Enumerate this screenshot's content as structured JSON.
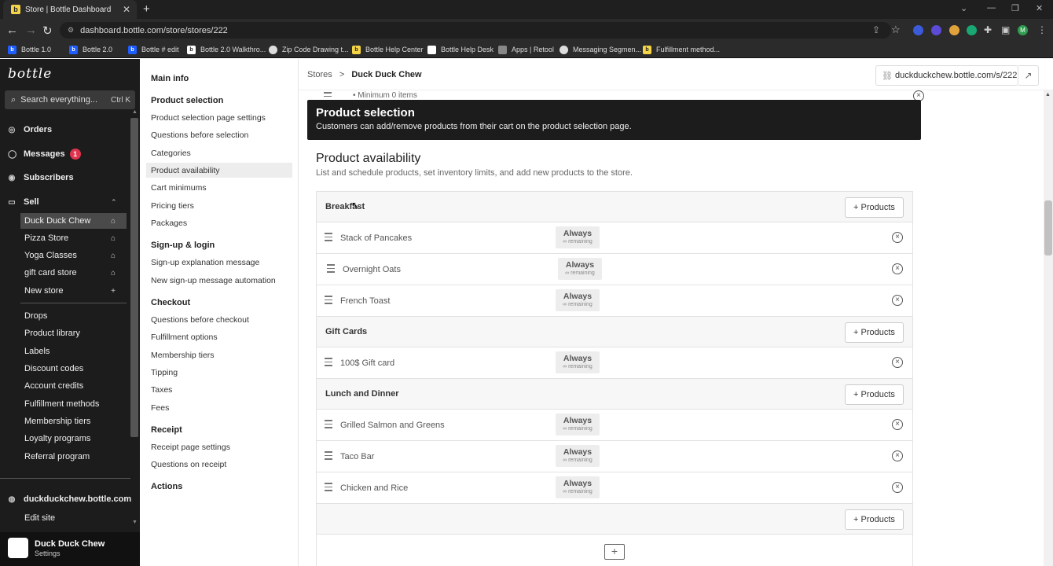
{
  "browser": {
    "tab_title": "Store | Bottle Dashboard",
    "tab_icon": "b",
    "url": "dashboard.bottle.com/store/stores/222",
    "bookmarks": [
      "Bottle 1.0",
      "Bottle 2.0",
      "Bottle # edit",
      "Bottle 2.0 Walkthro...",
      "Zip Code Drawing t...",
      "Bottle Help Center",
      "Bottle Help Desk",
      "Apps | Retool",
      "Messaging Segmen...",
      "Fulfillment method..."
    ],
    "profile_initial": "M"
  },
  "sidebar": {
    "logo": "bottle",
    "search_placeholder": "Search everything...",
    "search_shortcut": "Ctrl K",
    "orders": "Orders",
    "messages": "Messages",
    "messages_badge": "1",
    "subscribers": "Subscribers",
    "sell": "Sell",
    "stores": [
      "Duck Duck Chew",
      "Pizza Store",
      "Yoga Classes",
      "gift card store"
    ],
    "new_store": "New store",
    "items": [
      "Drops",
      "Product library",
      "Labels",
      "Discount codes",
      "Account credits",
      "Fulfillment methods",
      "Membership tiers",
      "Loyalty programs",
      "Referral program"
    ],
    "site_domain": "duckduckchew.bottle.com",
    "edit_site": "Edit site",
    "account_name": "Duck Duck Chew",
    "account_sub": "Settings"
  },
  "settings_nav": {
    "main_info": "Main info",
    "product_selection": "Product selection",
    "ps_items": [
      "Product selection page settings",
      "Questions before selection",
      "Categories",
      "Product availability",
      "Cart minimums",
      "Pricing tiers",
      "Packages"
    ],
    "signup": "Sign-up & login",
    "signup_items": [
      "Sign-up explanation message",
      "New sign-up message automation"
    ],
    "checkout": "Checkout",
    "checkout_items": [
      "Questions before checkout",
      "Fulfillment options",
      "Membership tiers",
      "Tipping",
      "Taxes",
      "Fees"
    ],
    "receipt": "Receipt",
    "receipt_items": [
      "Receipt page settings",
      "Questions on receipt"
    ],
    "actions": "Actions"
  },
  "header": {
    "crumb_root": "Stores",
    "crumb_sep": ">",
    "crumb_current": "Duck Duck Chew",
    "store_url": "duckduckchew.bottle.com/s/222"
  },
  "main": {
    "minimum_text": "•  Minimum 0 items",
    "banner_title": "Product selection",
    "banner_desc": "Customers can add/remove products from their cart on the product selection page.",
    "section_title": "Product availability",
    "section_sub": "List and schedule products, set inventory limits, and add new products to the store.",
    "add_products_label": "+ Products",
    "availability": "Always",
    "remaining": "∞ remaining",
    "groups": [
      {
        "name": "Breakfast",
        "products": [
          "Stack of Pancakes",
          "Overnight Oats",
          "French Toast"
        ]
      },
      {
        "name": "Gift Cards",
        "products": [
          "100$ Gift card"
        ]
      },
      {
        "name": "Lunch and Dinner",
        "products": [
          "Grilled Salmon and Greens",
          "Taco Bar",
          "Chicken and Rice"
        ]
      }
    ]
  }
}
